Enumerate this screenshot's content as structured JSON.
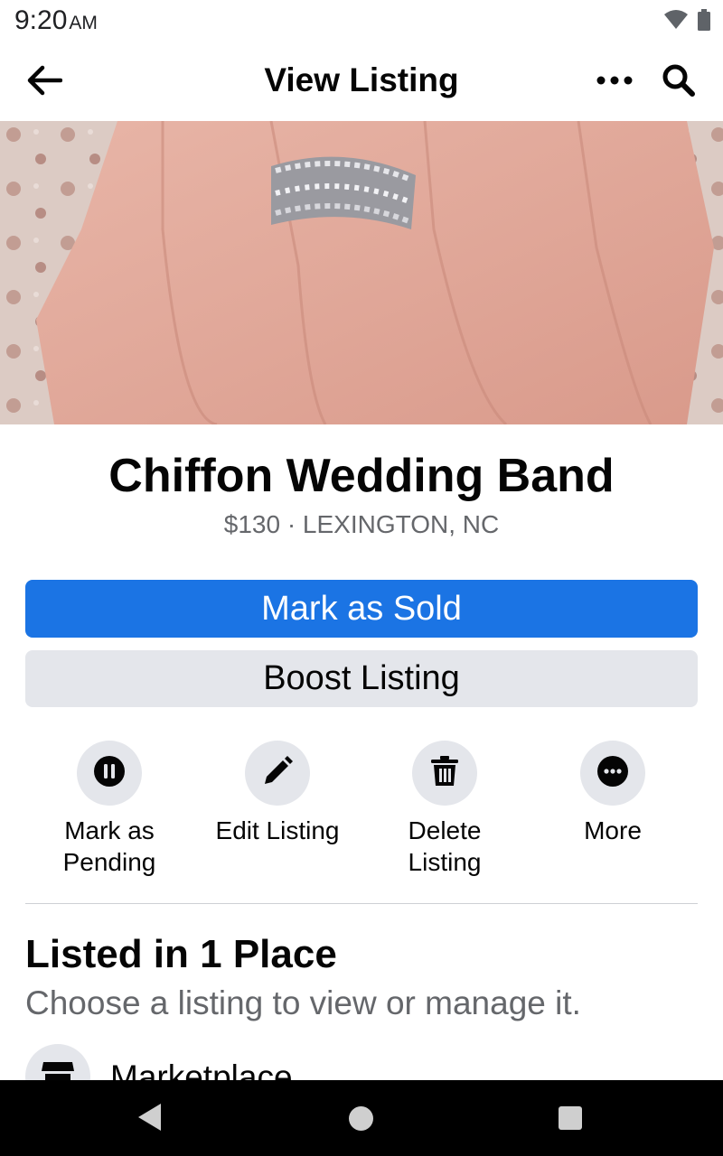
{
  "status_bar": {
    "time": "9:20",
    "ampm": "AM",
    "icons": [
      "wifi-icon",
      "battery-icon"
    ]
  },
  "app_bar": {
    "title": "View Listing",
    "icons": [
      "back-arrow-icon",
      "more-dots-icon",
      "search-icon"
    ]
  },
  "listing": {
    "photo_alt": "ring-on-hand-photo",
    "title": "Chiffon Wedding Band",
    "subtitle": "$130 · LEXINGTON, NC"
  },
  "buttons": {
    "primary": "Mark as Sold",
    "secondary": "Boost Listing"
  },
  "actions": [
    {
      "label_lines": [
        "Mark as",
        "Pending"
      ],
      "icon": "pause-icon"
    },
    {
      "label_lines": [
        "Edit Listing"
      ],
      "icon": "pencil-icon"
    },
    {
      "label_lines": [
        "Delete",
        "Listing"
      ],
      "icon": "trash-icon"
    },
    {
      "label_lines": [
        "More"
      ],
      "icon": "more-dots-icon"
    }
  ],
  "places": {
    "heading": "Listed in 1 Place",
    "subtext": "Choose a listing to view or manage it.",
    "items": [
      {
        "label": "Marketplace",
        "icon": "marketplace-icon"
      }
    ]
  },
  "colors": {
    "primary": "#1b74e4",
    "secondary_bg": "#e4e6eb",
    "text": "#050505",
    "muted": "#65676b"
  }
}
